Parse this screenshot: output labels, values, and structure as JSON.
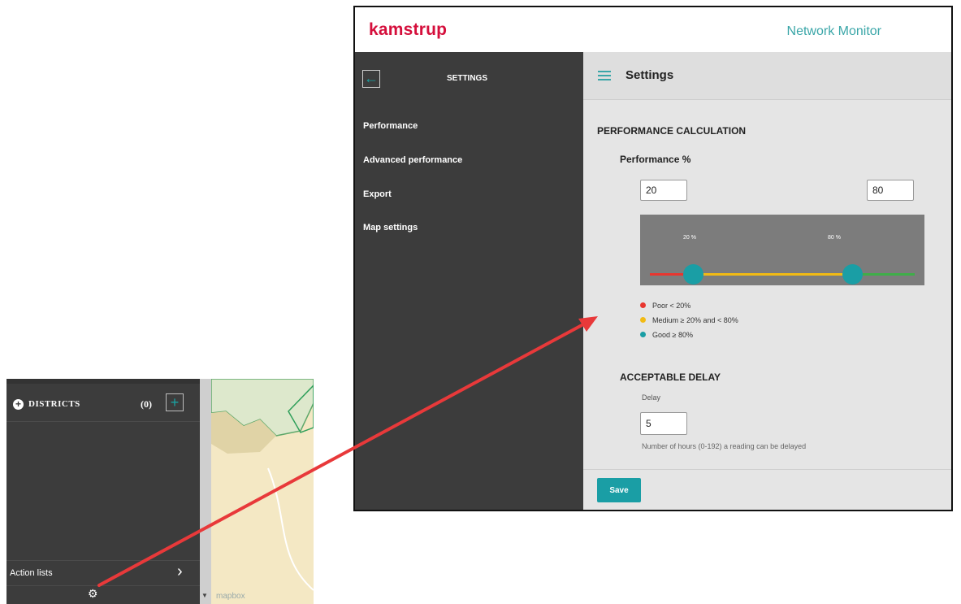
{
  "inset": {
    "districts_label": "DISTRICTS",
    "districts_count": "(0)",
    "add_label": "+",
    "action_lists_label": "Action lists",
    "map_attribution": "mapbox"
  },
  "header": {
    "brand": "kamstrup",
    "app_title": "Network Monitor"
  },
  "sidebar": {
    "title": "SETTINGS",
    "items": [
      {
        "label": "Performance"
      },
      {
        "label": "Advanced performance"
      },
      {
        "label": "Export"
      },
      {
        "label": "Map settings"
      }
    ]
  },
  "content": {
    "title": "Settings",
    "performance_calculation": {
      "title": "PERFORMANCE CALCULATION",
      "subtitle": "Performance %",
      "min_value": "20",
      "max_value": "80",
      "slider": {
        "low_label": "20 %",
        "high_label": "80 %",
        "low_fraction": 0.2,
        "high_fraction": 0.8
      },
      "legend": [
        {
          "label": "Poor < 20%",
          "color": "#e8362f"
        },
        {
          "label": "Medium ≥ 20% and < 80%",
          "color": "#f2bb14"
        },
        {
          "label": "Good ≥ 80%",
          "color": "#1a9ea5"
        }
      ]
    },
    "acceptable_delay": {
      "title": "ACCEPTABLE DELAY",
      "field_label": "Delay",
      "value": "5",
      "hint": "Number of hours (0-192) a reading can be delayed"
    },
    "save_label": "Save"
  },
  "colors": {
    "brand": "#d50f3c",
    "accent": "#1a9ea5",
    "poor": "#e8362f",
    "medium": "#f2bb14",
    "good": "#3fae49",
    "callout": "#e8393a"
  }
}
